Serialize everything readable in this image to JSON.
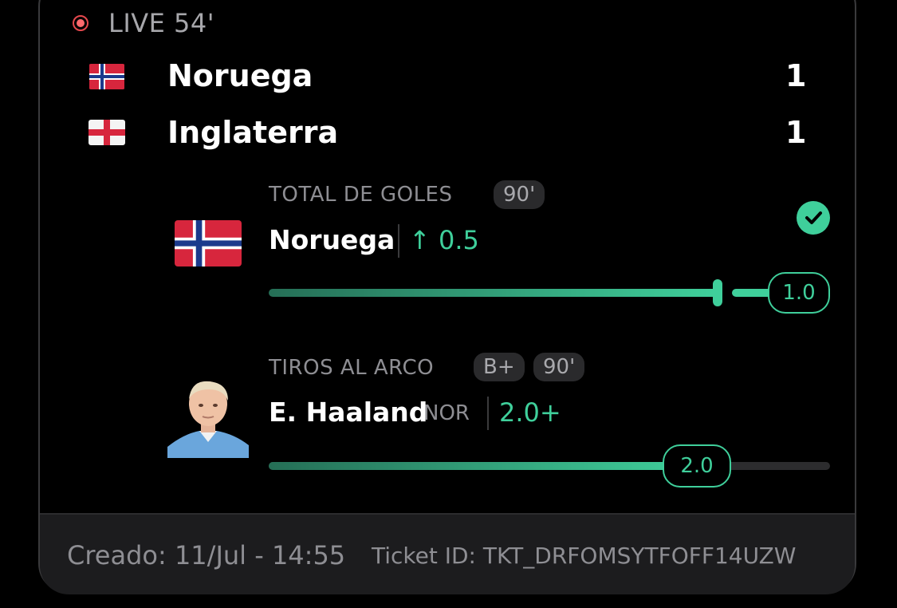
{
  "live": {
    "label": "LIVE 54'"
  },
  "teams": [
    {
      "name": "Noruega",
      "score": "1",
      "flag": "norway"
    },
    {
      "name": "Inglaterra",
      "score": "1",
      "flag": "england"
    }
  ],
  "bets": [
    {
      "market": "TOTAL DE GOLES",
      "badges": [
        "90'"
      ],
      "selection": "Noruega",
      "line": "↑ 0.5",
      "current_value": "1.0",
      "progress": 1.0,
      "status": "won",
      "icon": "norway-flag-icon"
    },
    {
      "market": "TIROS AL ARCO",
      "badges": [
        "B+",
        "90'"
      ],
      "selection": "E. Haaland",
      "team_code": "NOR",
      "line": "2.0+",
      "current_value": "2.0",
      "progress": 0.75,
      "icon": "player-avatar"
    }
  ],
  "footer": {
    "created": "Creado: 11/Jul - 14:55",
    "ticket": "Ticket ID: TKT_DRFOMSYTFOFF14UZW"
  },
  "colors": {
    "accent": "#3fcf9b",
    "live": "#ff6b6e",
    "muted": "#8e8e93"
  }
}
